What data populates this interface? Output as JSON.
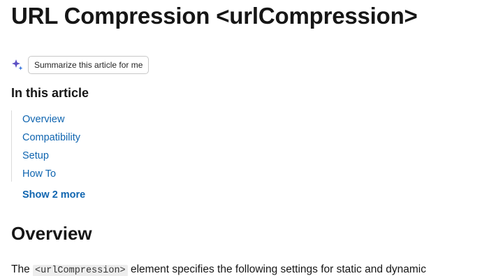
{
  "article": {
    "title": "URL Compression <urlCompression>",
    "summarize_button": "Summarize this article for me",
    "toc_heading": "In this article",
    "toc_items": [
      "Overview",
      "Compatibility",
      "Setup",
      "How To"
    ],
    "show_more": "Show 2 more",
    "section_heading": "Overview",
    "paragraph": {
      "prefix": "The",
      "code": "<urlCompression>",
      "suffix": "element specifies the following settings for static and dynamic"
    }
  },
  "colors": {
    "link": "#0f65b0",
    "text": "#161616",
    "sparkle": "#6b4fbb"
  },
  "icons": {
    "summarize": "sparkle-icon"
  }
}
